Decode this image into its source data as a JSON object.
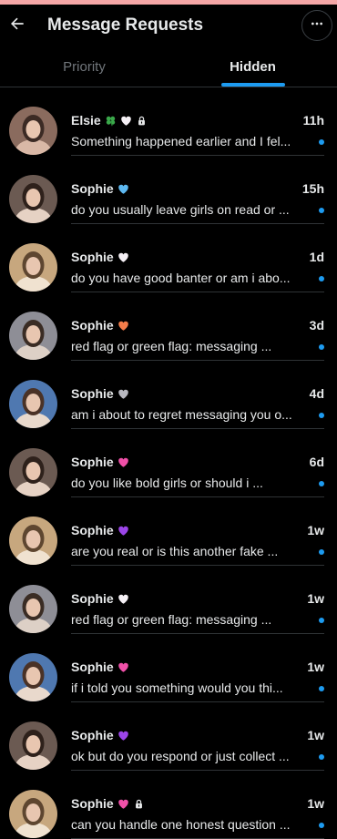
{
  "header": {
    "title": "Message Requests"
  },
  "tabs": [
    {
      "label": "Priority",
      "active": false
    },
    {
      "label": "Hidden",
      "active": true
    }
  ],
  "colors": {
    "accent": "#1d9bf0",
    "background": "#000000",
    "text": "#e7e9ea",
    "muted": "#71767b"
  },
  "messages": [
    {
      "name": "Elsie",
      "badges": [
        "clover-icon",
        "white-heart-icon",
        "lock-icon"
      ],
      "time": "11h",
      "preview": "Something happened earlier and I fel...",
      "unread": true
    },
    {
      "name": "Sophie",
      "badges": [
        "blue-heart-icon"
      ],
      "time": "15h",
      "preview": "do you usually leave girls on read or ...",
      "unread": true
    },
    {
      "name": "Sophie",
      "badges": [
        "white-heart-icon"
      ],
      "time": "1d",
      "preview": "do you have good banter or am i abo...",
      "unread": true
    },
    {
      "name": "Sophie",
      "badges": [
        "orange-heart-icon"
      ],
      "time": "3d",
      "preview": "red flag or green flag: messaging ...",
      "unread": true
    },
    {
      "name": "Sophie",
      "badges": [
        "grey-heart-icon"
      ],
      "time": "4d",
      "preview": "am i about to regret messaging you o...",
      "unread": true
    },
    {
      "name": "Sophie",
      "badges": [
        "pink-heart-icon"
      ],
      "time": "6d",
      "preview": "do you like bold girls or should i ...",
      "unread": true
    },
    {
      "name": "Sophie",
      "badges": [
        "purple-heart-icon"
      ],
      "time": "1w",
      "preview": "are you real or is this another fake ...",
      "unread": true
    },
    {
      "name": "Sophie",
      "badges": [
        "white-heart-icon"
      ],
      "time": "1w",
      "preview": "red flag or green flag: messaging ...",
      "unread": true
    },
    {
      "name": "Sophie",
      "badges": [
        "pink-heart-icon"
      ],
      "time": "1w",
      "preview": "if i told you something would you thi...",
      "unread": true
    },
    {
      "name": "Sophie",
      "badges": [
        "purple-heart-icon"
      ],
      "time": "1w",
      "preview": "ok but do you respond or just collect ...",
      "unread": true
    },
    {
      "name": "Sophie",
      "badges": [
        "pink-heart-icon",
        "lock-icon"
      ],
      "time": "1w",
      "preview": "can you handle one honest question ...",
      "unread": true
    }
  ]
}
